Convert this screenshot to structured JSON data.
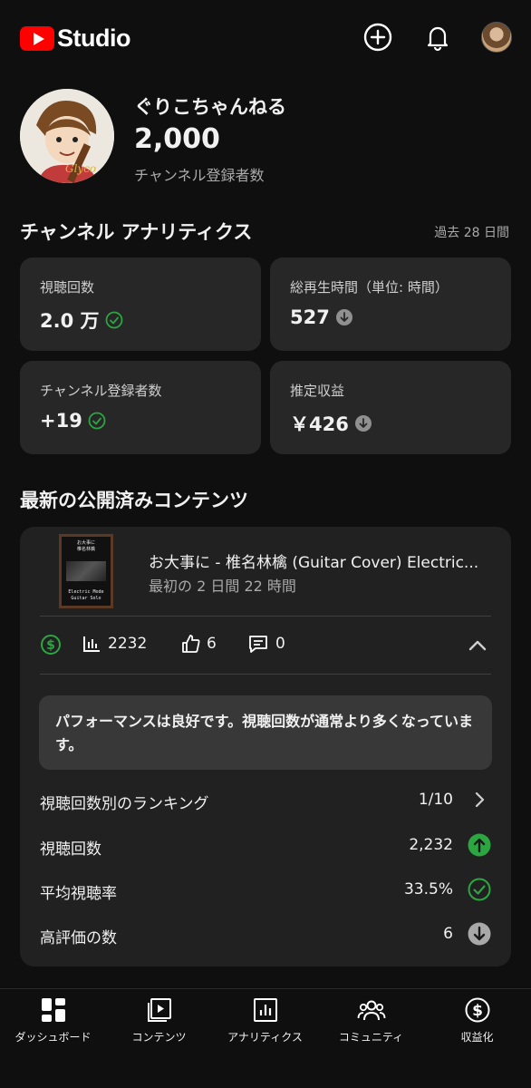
{
  "header": {
    "logo_text": "Studio",
    "icons": [
      "create-icon",
      "notifications-icon",
      "account-avatar"
    ]
  },
  "channel": {
    "name": "ぐりこちゃんねる",
    "subscribers": "2,000",
    "subscribers_label": "チャンネル登録者数"
  },
  "analytics": {
    "title": "チャンネル アナリティクス",
    "period": "過去 28 日間",
    "cards": [
      {
        "label": "視聴回数",
        "value": "2.0 万",
        "status": "check"
      },
      {
        "label": "総再生時間（単位: 時間）",
        "value": "527",
        "status": "down"
      },
      {
        "label": "チャンネル登録者数",
        "value": "+19",
        "status": "check"
      },
      {
        "label": "推定収益",
        "value": "￥426",
        "status": "down"
      }
    ]
  },
  "latest_content": {
    "title": "最新の公開済みコンテンツ",
    "video": {
      "title": "お大事に - 椎名林檎 (Guitar Cover) Electric...",
      "subtitle": "最初の 2 日間 22 時間"
    },
    "stats": {
      "views": "2232",
      "likes": "6",
      "comments": "0"
    },
    "performance_message": "パフォーマンスは良好です。視聴回数が通常より多くなっています。",
    "metrics": [
      {
        "label": "視聴回数別のランキング",
        "value": "1/10",
        "icon": "chevron-right-icon"
      },
      {
        "label": "視聴回数",
        "value": "2,232",
        "icon": "arrow-up-icon"
      },
      {
        "label": "平均視聴率",
        "value": "33.5%",
        "icon": "check-icon"
      },
      {
        "label": "高評価の数",
        "value": "6",
        "icon": "arrow-down-icon"
      }
    ]
  },
  "bottom_nav": [
    {
      "label": "ダッシュボード",
      "icon": "dashboard-icon"
    },
    {
      "label": "コンテンツ",
      "icon": "content-icon"
    },
    {
      "label": "アナリティクス",
      "icon": "analytics-icon"
    },
    {
      "label": "コミュニティ",
      "icon": "community-icon"
    },
    {
      "label": "収益化",
      "icon": "monetization-icon"
    }
  ],
  "colors": {
    "background": "#0f0f0f",
    "card": "#272727",
    "brand_red": "#ff0000",
    "positive_green": "#2ba640",
    "muted_text": "#aaaaaa"
  }
}
